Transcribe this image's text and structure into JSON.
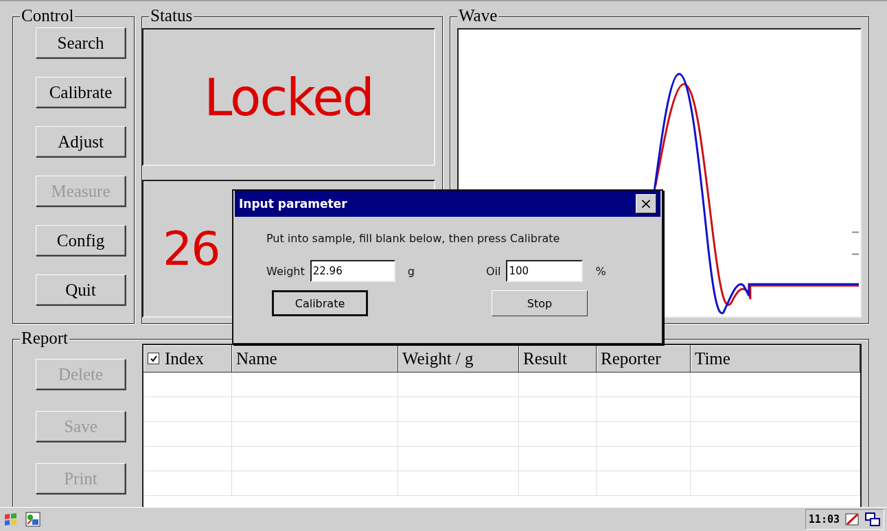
{
  "control": {
    "title": "Control",
    "buttons": [
      {
        "label": "Search",
        "disabled": false
      },
      {
        "label": "Calibrate",
        "disabled": false
      },
      {
        "label": "Adjust",
        "disabled": false
      },
      {
        "label": "Measure",
        "disabled": true
      },
      {
        "label": "Config",
        "disabled": false
      },
      {
        "label": "Quit",
        "disabled": false
      }
    ]
  },
  "status": {
    "title": "Status",
    "state": "Locked",
    "reading": "26"
  },
  "wave": {
    "title": "Wave"
  },
  "report": {
    "title": "Report",
    "buttons": [
      {
        "label": "Delete",
        "disabled": true
      },
      {
        "label": "Save",
        "disabled": true
      },
      {
        "label": "Print",
        "disabled": true
      }
    ],
    "table": {
      "select_all": {
        "checked": true
      },
      "columns": [
        "Index",
        "Name",
        "Weight / g",
        "Result",
        "Reporter",
        "Time"
      ]
    }
  },
  "dialog": {
    "title": "Input parameter",
    "close": "×",
    "message": "Put into sample, fill blank below, then press Calibrate",
    "fields": [
      {
        "label": "Weight",
        "value": "22.96",
        "unit": "g"
      },
      {
        "label": "Oil",
        "value": "100",
        "unit": "%"
      }
    ],
    "buttons": [
      {
        "label": "Calibrate",
        "default": true
      },
      {
        "label": "Stop",
        "default": false
      }
    ]
  },
  "taskbar": {
    "clock": "11:03"
  }
}
